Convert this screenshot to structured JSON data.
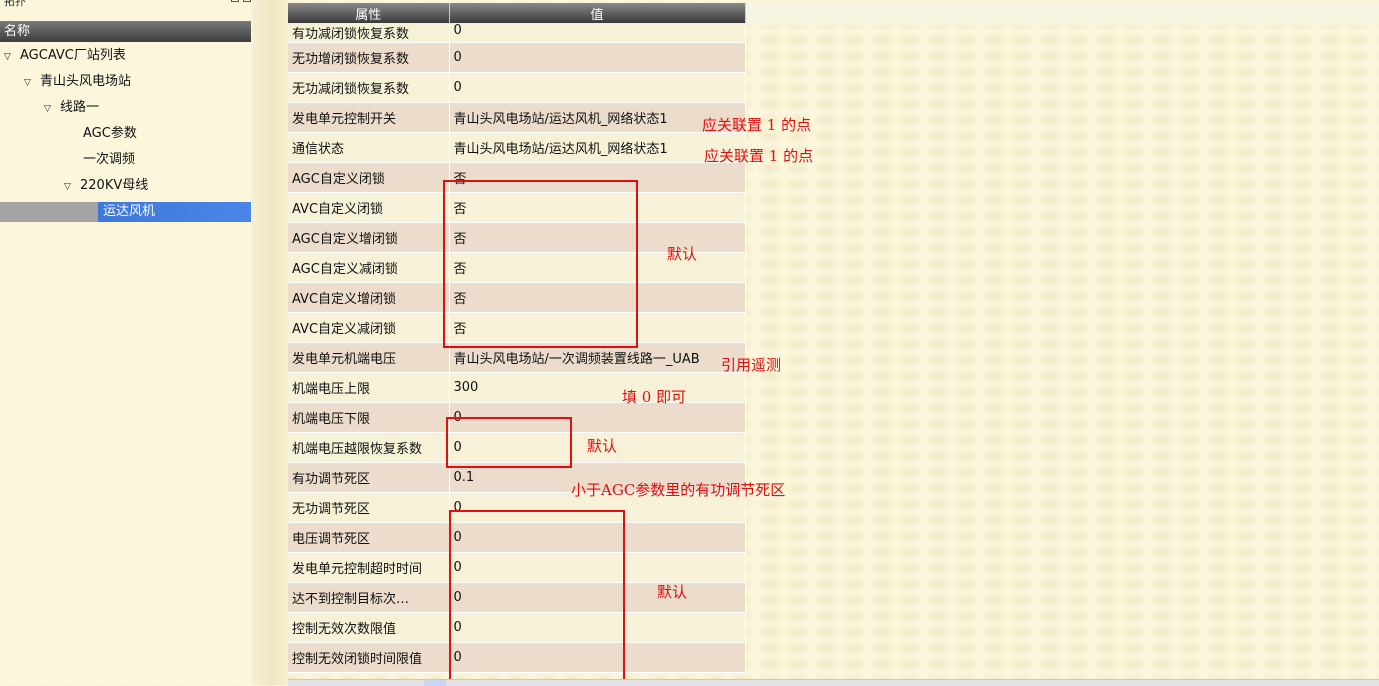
{
  "tree": {
    "panel_title": "拓扑",
    "header": "名称",
    "nodes": [
      {
        "label": "AGCAVC厂站列表",
        "toggle": "▽"
      },
      {
        "label": "青山头风电场站",
        "toggle": "▽"
      },
      {
        "label": "线路一",
        "toggle": "▽"
      },
      {
        "label": "AGC参数",
        "toggle": ""
      },
      {
        "label": "一次调频",
        "toggle": ""
      },
      {
        "label": "220KV母线",
        "toggle": "▽"
      },
      {
        "label": "运达风机",
        "toggle": ""
      }
    ]
  },
  "grid": {
    "col_attr": "属性",
    "col_value": "值",
    "rows": [
      {
        "attr": "有功减闭锁恢复系数",
        "value": "0"
      },
      {
        "attr": "无功增闭锁恢复系数",
        "value": "0"
      },
      {
        "attr": "无功减闭锁恢复系数",
        "value": "0"
      },
      {
        "attr": "发电单元控制开关",
        "value": "青山头风电场站/运达风机_网络状态1"
      },
      {
        "attr": "通信状态",
        "value": "青山头风电场站/运达风机_网络状态1"
      },
      {
        "attr": "AGC自定义闭锁",
        "value": "否"
      },
      {
        "attr": "AVC自定义闭锁",
        "value": "否"
      },
      {
        "attr": "AGC自定义增闭锁",
        "value": "否"
      },
      {
        "attr": "AGC自定义减闭锁",
        "value": "否"
      },
      {
        "attr": "AVC自定义增闭锁",
        "value": "否"
      },
      {
        "attr": "AVC自定义减闭锁",
        "value": "否"
      },
      {
        "attr": "发电单元机端电压",
        "value": "青山头风电场站/一次调频装置线路一_UAB"
      },
      {
        "attr": "机端电压上限",
        "value": "300"
      },
      {
        "attr": "机端电压下限",
        "value": "0"
      },
      {
        "attr": "机端电压越限恢复系数",
        "value": "0"
      },
      {
        "attr": "有功调节死区",
        "value": "0.1"
      },
      {
        "attr": "无功调节死区",
        "value": "0"
      },
      {
        "attr": "电压调节死区",
        "value": "0"
      },
      {
        "attr": "发电单元控制超时时间",
        "value": "0"
      },
      {
        "attr": "达不到控制目标次…",
        "value": "0"
      },
      {
        "attr": "控制无效次数限值",
        "value": "0"
      },
      {
        "attr": "控制无效闭锁时间限值",
        "value": "0"
      }
    ]
  },
  "annotations": {
    "note_switch": "应关联置 1 的点",
    "note_comm": "应关联置 1 的点",
    "note_default_1": "默认",
    "note_voltage_ref": "引用遥测",
    "note_upper_limit": "填 0 即可",
    "note_default_2": "默认",
    "note_deadband": "小于AGC参数里的有功调节死区",
    "note_default_3": "默认",
    "color": "#e01010"
  },
  "colors": {
    "row_odd": "#f7f1d8",
    "row_even": "#ebdccb",
    "selection": "#4a86e8",
    "header_dark": "#3e3e3e",
    "background": "#fbf6dc"
  }
}
